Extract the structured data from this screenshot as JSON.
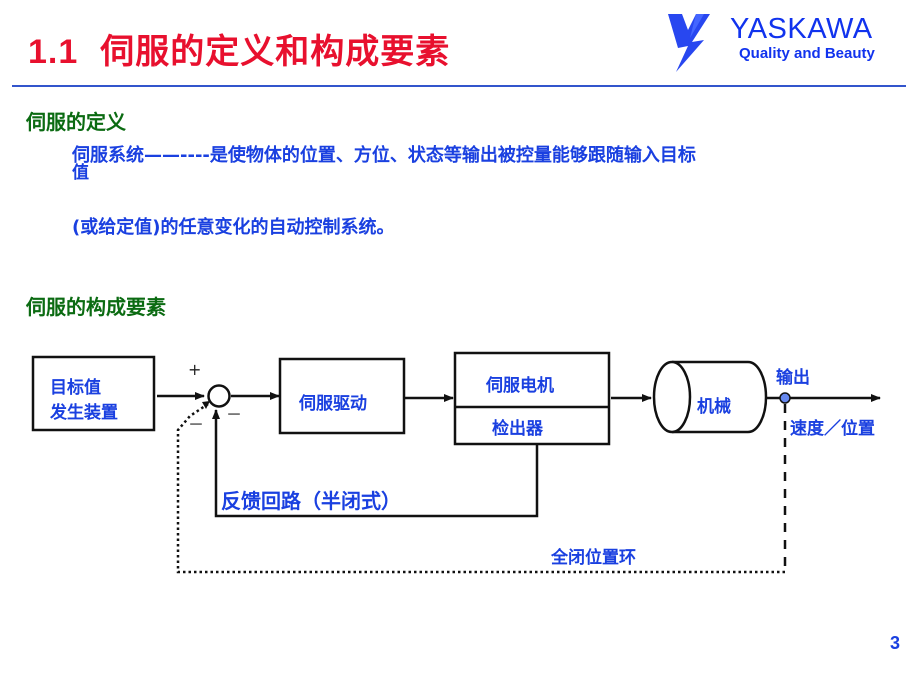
{
  "header": {
    "section_number": "1.1",
    "title": "伺服的定义和构成要素",
    "logo": {
      "icon": "yaskawa-logo-icon",
      "brand": "YASKAWA",
      "tagline": "Quality and Beauty"
    }
  },
  "definition": {
    "heading": "伺服的定义",
    "line1": "伺服系统——----是使物体的位置、方位、状态等输出被控量能够跟随输入目标",
    "line1_overflow": "值",
    "line2": "(或给定值)的任意变化的自动控制系统。"
  },
  "components": {
    "heading": "伺服的构成要素",
    "diagram": {
      "blocks": {
        "target_generator": [
          "目标值",
          "发生装置"
        ],
        "servo_drive": "伺服驱动",
        "servo_motor": "伺服电机",
        "detector": "检出器",
        "machine": "机械"
      },
      "summing_junction": {
        "plus": "+",
        "minus_bottom": "－",
        "minus_left": "－"
      },
      "output_label": "输出",
      "measured_label": "速度／位置",
      "semi_closed_loop_label": "反馈回路（半闭式）",
      "full_closed_loop_label": "全闭位置环"
    }
  },
  "footer": {
    "page_number": "3"
  },
  "colors": {
    "title": "#e8102e",
    "heading": "#0b6b12",
    "body": "#1a40e0",
    "brand": "#1133ee",
    "rule": "#3355cc"
  }
}
